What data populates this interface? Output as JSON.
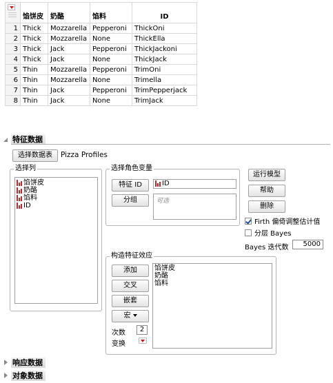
{
  "table": {
    "headers": [
      "馅饼皮",
      "奶酪",
      "馅料",
      "ID"
    ],
    "rows": [
      {
        "n": "1",
        "crust": "Thick",
        "cheese": "Mozzarella",
        "topping": "Pepperoni",
        "id": "ThickOni"
      },
      {
        "n": "2",
        "crust": "Thick",
        "cheese": "Mozzarella",
        "topping": "None",
        "id": "ThickElla"
      },
      {
        "n": "3",
        "crust": "Thick",
        "cheese": "Jack",
        "topping": "Pepperoni",
        "id": "ThickJackoni"
      },
      {
        "n": "4",
        "crust": "Thick",
        "cheese": "Jack",
        "topping": "None",
        "id": "ThickJack"
      },
      {
        "n": "5",
        "crust": "Thin",
        "cheese": "Mozzarella",
        "topping": "Pepperoni",
        "id": "TrimOni"
      },
      {
        "n": "6",
        "crust": "Thin",
        "cheese": "Mozzarella",
        "topping": "None",
        "id": "Trimella"
      },
      {
        "n": "7",
        "crust": "Thin",
        "cheese": "Jack",
        "topping": "Pepperoni",
        "id": "TrimPepperjack"
      },
      {
        "n": "8",
        "crust": "Thin",
        "cheese": "Jack",
        "topping": "None",
        "id": "TrimJack"
      }
    ]
  },
  "features": {
    "title": "特征数据",
    "select_table_btn": "选择数据表",
    "table_name": "Pizza Profiles",
    "select_columns": {
      "title": "选择列",
      "items": [
        "馅饼皮",
        "奶酪",
        "馅料",
        "ID"
      ]
    },
    "roles": {
      "title": "选择角色变量",
      "feature_id_btn": "特征 ID",
      "feature_id_value": "ID",
      "group_btn": "分组",
      "group_placeholder": "可选"
    },
    "actions": {
      "run": "运行模型",
      "help": "帮助",
      "remove": "删除"
    },
    "options": {
      "firth_label": "Firth 偏倚调整估计值",
      "firth_checked": true,
      "bayes_label": "分层 Bayes",
      "bayes_checked": false,
      "iterations_label": "Bayes 迭代数",
      "iterations_value": "5000"
    },
    "effects": {
      "title": "构造特征效应",
      "add": "添加",
      "cross": "交叉",
      "nest": "嵌套",
      "macros": "宏",
      "degree_label": "次数",
      "degree_value": "2",
      "transform_label": "变换",
      "items": [
        "馅饼皮",
        "奶酪",
        "馅料"
      ]
    }
  },
  "response": {
    "title": "响应数据"
  },
  "subject": {
    "title": "对象数据"
  }
}
